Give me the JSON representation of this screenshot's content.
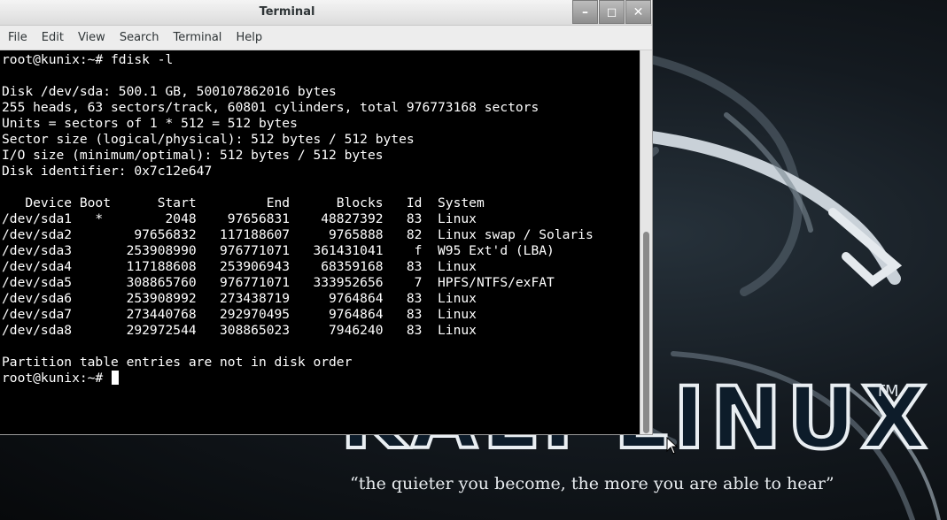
{
  "desktop": {
    "brand_text": "KALI LINUX",
    "trademark": "TM",
    "tagline": "“the quieter you become, the more you are able to hear”"
  },
  "window": {
    "title": "Terminal",
    "buttons": {
      "minimize": "–",
      "maximize": "◻",
      "close": "✕"
    }
  },
  "menubar": {
    "items": [
      "File",
      "Edit",
      "View",
      "Search",
      "Terminal",
      "Help"
    ]
  },
  "terminal": {
    "lines": [
      "root@kunix:~# fdisk -l",
      "",
      "Disk /dev/sda: 500.1 GB, 500107862016 bytes",
      "255 heads, 63 sectors/track, 60801 cylinders, total 976773168 sectors",
      "Units = sectors of 1 * 512 = 512 bytes",
      "Sector size (logical/physical): 512 bytes / 512 bytes",
      "I/O size (minimum/optimal): 512 bytes / 512 bytes",
      "Disk identifier: 0x7c12e647",
      "",
      "   Device Boot      Start         End      Blocks   Id  System",
      "/dev/sda1   *        2048    97656831    48827392   83  Linux",
      "/dev/sda2        97656832   117188607     9765888   82  Linux swap / Solaris",
      "/dev/sda3       253908990   976771071   361431041    f  W95 Ext'd (LBA)",
      "/dev/sda4       117188608   253906943    68359168   83  Linux",
      "/dev/sda5       308865760   976771071   333952656    7  HPFS/NTFS/exFAT",
      "/dev/sda6       253908992   273438719     9764864   83  Linux",
      "/dev/sda7       273440768   292970495     9764864   83  Linux",
      "/dev/sda8       292972544   308865023     7946240   83  Linux",
      "",
      "Partition table entries are not in disk order"
    ],
    "prompt": "root@kunix:~# "
  },
  "icons": {
    "minimize": "minimize-icon",
    "maximize": "maximize-icon",
    "close": "close-icon",
    "pointer": "mouse-pointer-icon",
    "dragon": "kali-dragon-icon"
  },
  "colors": {
    "terminal_bg": "#000000",
    "terminal_fg": "#ffffff",
    "titlebar": "#e4e4e4"
  }
}
